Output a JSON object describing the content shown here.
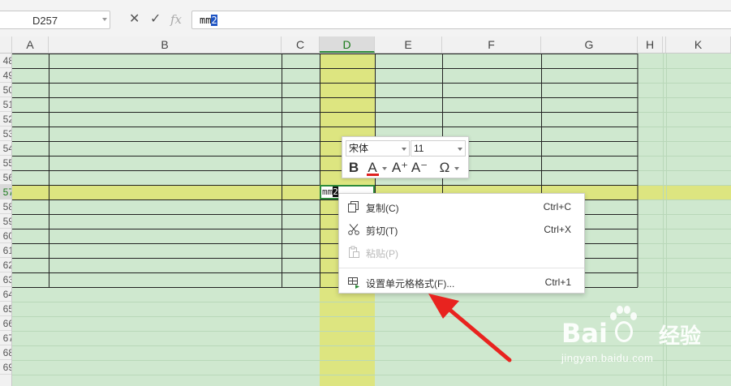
{
  "formula_bar": {
    "name_box": "D257",
    "cancel_icon": "✕",
    "confirm_icon": "✓",
    "fx_label": "fx",
    "content_plain": "mm",
    "content_selected": "2"
  },
  "columns": [
    "A",
    "B",
    "C",
    "D",
    "E",
    "F",
    "G",
    "H",
    "K"
  ],
  "active_column": "D",
  "rows": [
    "48",
    "49",
    "50",
    "51",
    "52",
    "53",
    "54",
    "55",
    "56",
    "57",
    "58",
    "59",
    "60",
    "61",
    "62",
    "63",
    "64",
    "65",
    "66",
    "67",
    "68",
    "69"
  ],
  "active_row": "57",
  "cell_editor": {
    "content_plain": "mm",
    "content_selected": "2"
  },
  "mini_toolbar": {
    "font_name": "宋体",
    "font_size": "11",
    "bold_label": "B",
    "font_color_label": "A",
    "font_color_accent": "#e02020",
    "grow_font_label": "A⁺",
    "shrink_font_label": "A⁻",
    "symbol_label": "Ω"
  },
  "context_menu": {
    "items": [
      {
        "label": "复制(C)",
        "shortcut": "Ctrl+C",
        "icon": "copy-icon",
        "enabled": true
      },
      {
        "label": "剪切(T)",
        "shortcut": "Ctrl+X",
        "icon": "scissors-icon",
        "enabled": true
      },
      {
        "label": "粘贴(P)",
        "shortcut": "",
        "icon": "paste-icon",
        "enabled": false
      },
      {
        "label": "设置单元格格式(F)...",
        "shortcut": "Ctrl+1",
        "icon": "format-cells-icon",
        "enabled": true
      }
    ]
  },
  "watermark": {
    "brand": "Bai",
    "brand_suffix": "经验",
    "url": "jingyan.baidu.com"
  },
  "colors": {
    "sheet_bg": "#cfe8cf",
    "selection_fill": "#dde580",
    "arrow": "#e8231f",
    "active_header": "#2e8b3a"
  }
}
